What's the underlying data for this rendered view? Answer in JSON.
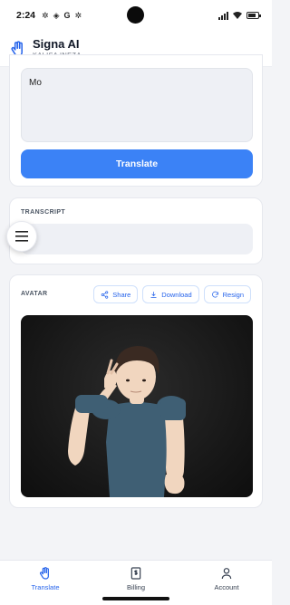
{
  "status_bar": {
    "time": "2:24",
    "glyphs": [
      "✲",
      "◈",
      "G",
      "✲"
    ],
    "icons": [
      "signal-icon",
      "wifi-icon",
      "battery-icon"
    ]
  },
  "header": {
    "title": "Signa AI",
    "subtitle": "KALISA INEZA",
    "logo_icon": "hand-icon"
  },
  "input": {
    "value": "Mo",
    "translate_label": "Translate"
  },
  "transcript": {
    "label": "TRANSCRIPT",
    "value": "o"
  },
  "avatar": {
    "label": "AVATAR",
    "actions": [
      {
        "label": "Share",
        "icon": "share-icon"
      },
      {
        "label": "Download",
        "icon": "download-icon"
      },
      {
        "label": "Resign",
        "icon": "refresh-icon"
      }
    ]
  },
  "fab": {
    "icon": "menu-icon"
  },
  "nav": {
    "items": [
      {
        "label": "Translate",
        "icon": "hand-icon",
        "active": true
      },
      {
        "label": "Billing",
        "icon": "receipt-dollar-icon",
        "active": false
      },
      {
        "label": "Account",
        "icon": "user-icon",
        "active": false
      }
    ]
  },
  "colors": {
    "accent": "#3b82f6",
    "accent_text": "#2563eb",
    "background": "#f3f4f7"
  }
}
